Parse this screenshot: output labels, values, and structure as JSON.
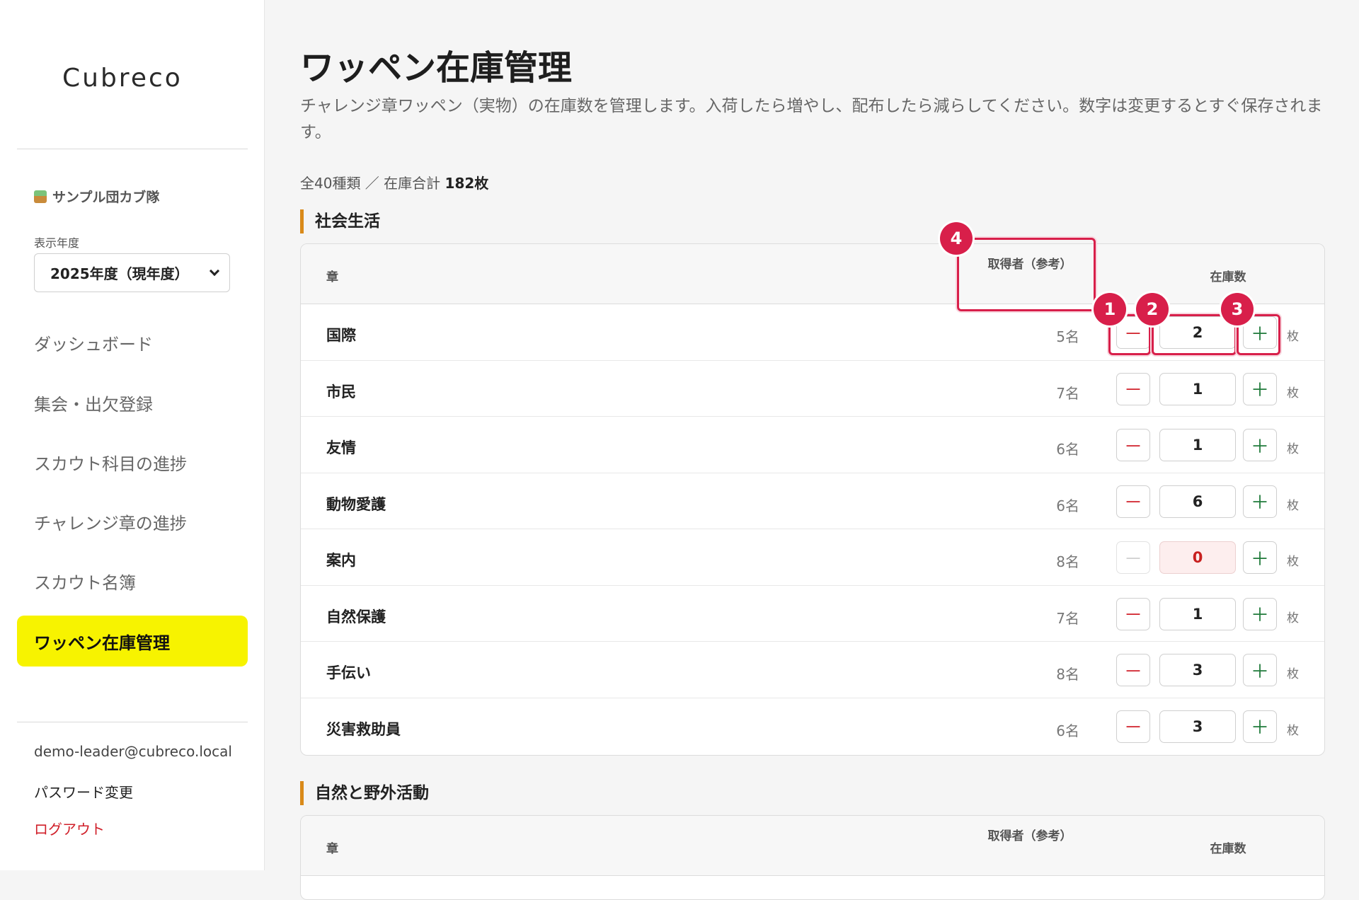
{
  "sidebar": {
    "logo": "Cubreco",
    "troop_name": "サンプル団カブ隊",
    "year_label": "表示年度",
    "year_selected": "2025年度（現年度）",
    "nav": [
      {
        "label": "ダッシュボード"
      },
      {
        "label": "集会・出欠登録"
      },
      {
        "label": "スカウト科目の進捗"
      },
      {
        "label": "チャレンジ章の進捗"
      },
      {
        "label": "スカウト名簿"
      },
      {
        "label": "ワッペン在庫管理",
        "active": true
      }
    ],
    "email": "demo-leader@cubreco.local",
    "password_link": "パスワード変更",
    "logout": "ログアウト"
  },
  "main": {
    "title": "ワッペン在庫管理",
    "description": "チャレンジ章ワッペン（実物）の在庫数を管理します。入荷したら増やし、配布したら減らしてください。数字は変更するとすぐ保存されます。",
    "summary_prefix": "全40種類 ／ 在庫合計 ",
    "summary_total": "182枚",
    "table_headers": {
      "chapter": "章",
      "holders": "取得者（参考）",
      "stock": "在庫数"
    },
    "sections": [
      {
        "title": "社会生活",
        "rows": [
          {
            "name": "国際",
            "holders": "5名",
            "stock": "2"
          },
          {
            "name": "市民",
            "holders": "7名",
            "stock": "1"
          },
          {
            "name": "友情",
            "holders": "6名",
            "stock": "1"
          },
          {
            "name": "動物愛護",
            "holders": "6名",
            "stock": "6"
          },
          {
            "name": "案内",
            "holders": "8名",
            "stock": "0"
          },
          {
            "name": "自然保護",
            "holders": "7名",
            "stock": "1"
          },
          {
            "name": "手伝い",
            "holders": "8名",
            "stock": "3"
          },
          {
            "name": "災害救助員",
            "holders": "6名",
            "stock": "3"
          }
        ]
      },
      {
        "title": "自然と野外活動",
        "rows": []
      }
    ],
    "minus_symbol": "－",
    "plus_symbol": "＋",
    "unit": "枚"
  },
  "annotations": [
    "1",
    "2",
    "3",
    "4"
  ],
  "colors": {
    "accent_yellow": "#f7f300",
    "section_bar": "#d98a1a",
    "highlight": "#d81f4a",
    "minus": "#d0202a",
    "plus": "#1f7a3a"
  }
}
